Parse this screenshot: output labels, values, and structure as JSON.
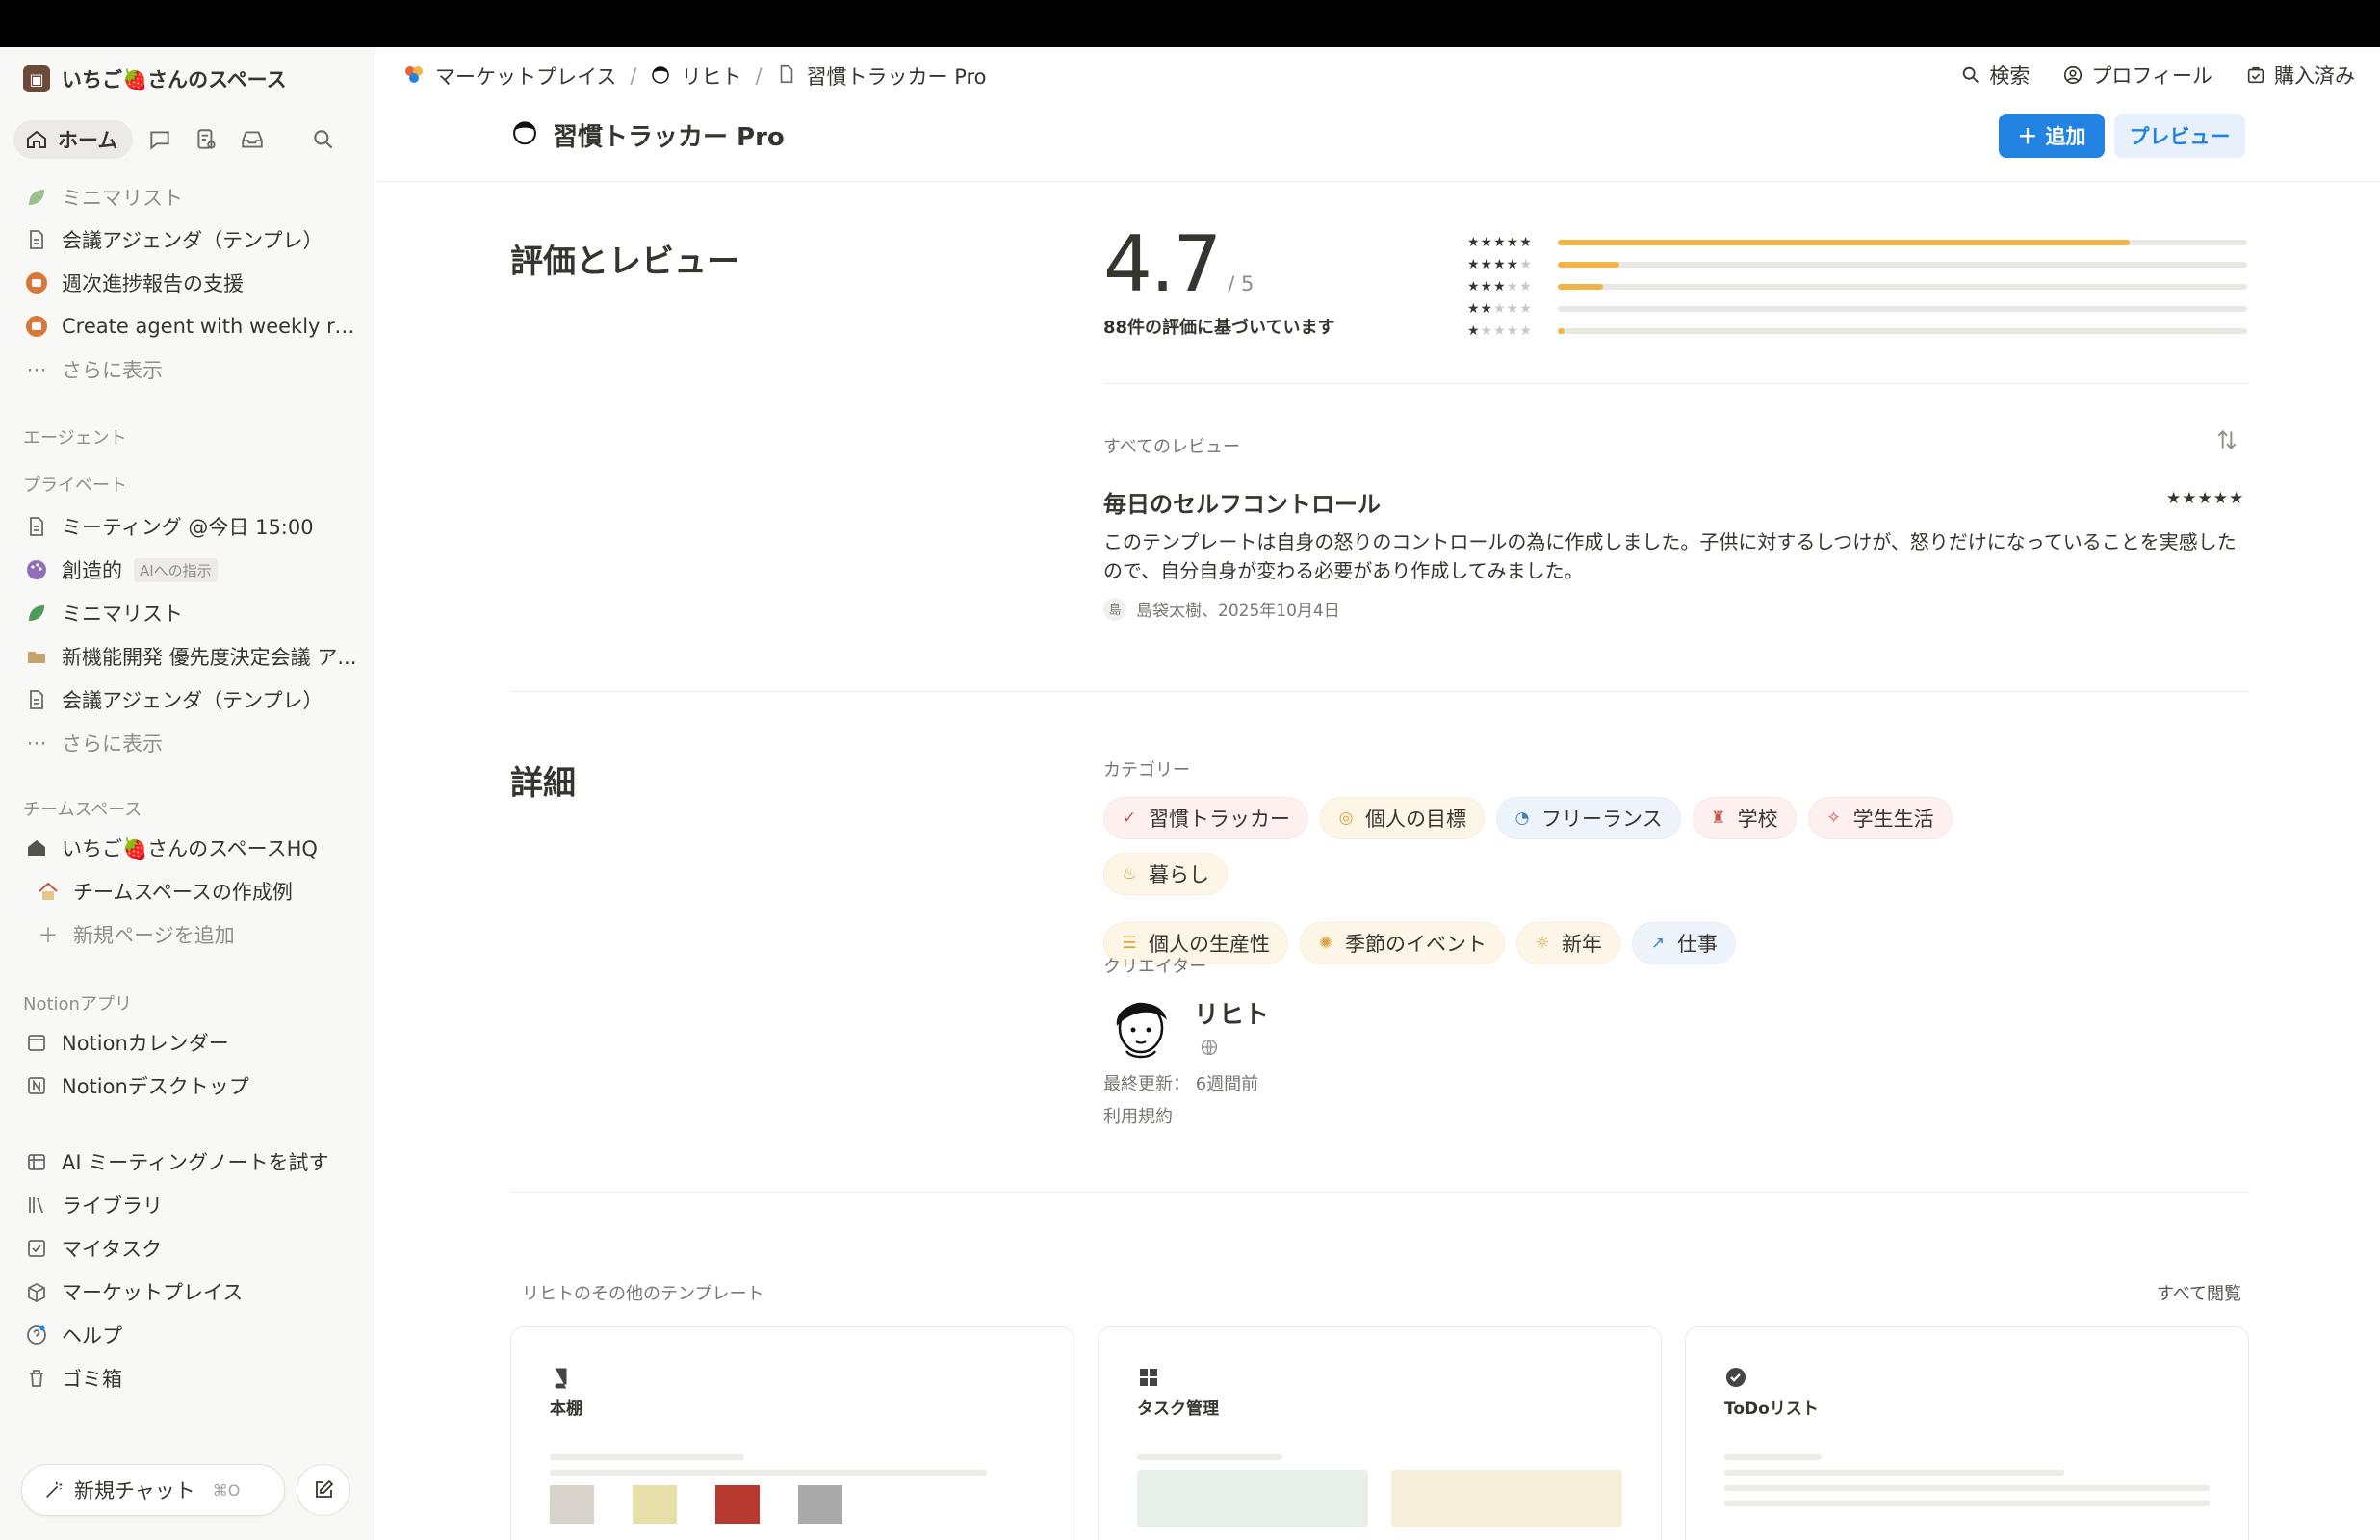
{
  "workspace": {
    "name": "いちご🍓さんのスペース"
  },
  "nav": {
    "home": "ホーム"
  },
  "sidebar": {
    "recent": [
      {
        "label": "ミニマリスト",
        "icon": "leaf-icon"
      },
      {
        "label": "会議アジェンダ（テンプレ）",
        "icon": "page-icon"
      },
      {
        "label": "週次進捗報告の支援",
        "icon": "agent-icon"
      },
      {
        "label": "Create agent with weekly rep...",
        "icon": "agent-icon"
      }
    ],
    "more1": "さらに表示",
    "agents_head": "エージェント",
    "private_head": "プライベート",
    "private": [
      {
        "label": "ミーティング @今日 15:00",
        "icon": "page-icon"
      },
      {
        "label": "創造的",
        "icon": "palette-icon",
        "tag": "AIへの指示"
      },
      {
        "label": "ミニマリスト",
        "icon": "leaf-icon"
      },
      {
        "label": "新機能開発 優先度決定会議 ア...",
        "icon": "folder-icon"
      },
      {
        "label": "会議アジェンダ（テンプレ）",
        "icon": "page-icon"
      }
    ],
    "more2": "さらに表示",
    "team_head": "チームスペース",
    "team": [
      {
        "label": "いちご🍓さんのスペースHQ",
        "icon": "home-icon"
      },
      {
        "label": "チームスペースの作成例",
        "icon": "house-emoji-icon"
      },
      {
        "label": "新規ページを追加",
        "icon": "plus-icon"
      }
    ],
    "apps_head": "Notionアプリ",
    "apps": [
      {
        "label": "Notionカレンダー",
        "icon": "calendar-icon"
      },
      {
        "label": "Notionデスクトップ",
        "icon": "notion-icon"
      }
    ],
    "bottom": [
      {
        "label": "AI ミーティングノートを試す",
        "icon": "calendar-grid-icon"
      },
      {
        "label": "ライブラリ",
        "icon": "library-icon"
      },
      {
        "label": "マイタスク",
        "icon": "checkbox-icon"
      },
      {
        "label": "マーケットプレイス",
        "icon": "marketplace-icon"
      },
      {
        "label": "ヘルプ",
        "icon": "help-icon"
      },
      {
        "label": "ゴミ箱",
        "icon": "trash-icon"
      }
    ],
    "new_chat": "新規チャット",
    "new_chat_kbd": "⌘O"
  },
  "breadcrumb": [
    "マーケットプレイス",
    "リヒト",
    "習慣トラッカー Pro"
  ],
  "header": {
    "search": "検索",
    "profile": "プロフィール",
    "purchased": "購入済み"
  },
  "title": "習慣トラッカー Pro",
  "buttons": {
    "add": "追加",
    "preview": "プレビュー"
  },
  "ratings": {
    "section_title": "評価とレビュー",
    "score": "4.7",
    "out_of": "/ 5",
    "based_on": "88件の評価に基づいています",
    "distribution": [
      {
        "stars": 5,
        "fraction": 0.83
      },
      {
        "stars": 4,
        "fraction": 0.09
      },
      {
        "stars": 3,
        "fraction": 0.065
      },
      {
        "stars": 2,
        "fraction": 0.0
      },
      {
        "stars": 1,
        "fraction": 0.01
      }
    ]
  },
  "reviews": {
    "label": "すべてのレビュー",
    "items": [
      {
        "title": "毎日のセルフコントロール",
        "stars": "★★★★★",
        "body": "このテンプレートは自身の怒りのコントロールの為に作成しました。子供に対するしつけが、怒りだけになっていることを実感したので、自分自身が変わる必要があり作成してみました。",
        "avatar": "島",
        "meta": "島袋太樹、2025年10月4日"
      }
    ]
  },
  "details": {
    "section_title": "詳細",
    "categories_label": "カテゴリー",
    "categories": [
      {
        "label": "習慣トラッカー",
        "glyph": "✓",
        "bg": "#fdf0ee",
        "fg": "#c4554d"
      },
      {
        "label": "個人の目標",
        "glyph": "◎",
        "bg": "#fdf5e6",
        "fg": "#d9a23a"
      },
      {
        "label": "フリーランス",
        "glyph": "◔",
        "bg": "#eef4fb",
        "fg": "#3f7fc7"
      },
      {
        "label": "学校",
        "glyph": "♜",
        "bg": "#fdf0ee",
        "fg": "#c4554d"
      },
      {
        "label": "学生生活",
        "glyph": "✧",
        "bg": "#fdf0ee",
        "fg": "#c4554d"
      },
      {
        "label": "暮らし",
        "glyph": "♨",
        "bg": "#fdf6e6",
        "fg": "#d9a23a"
      },
      {
        "label": "個人の生産性",
        "glyph": "☰",
        "bg": "#fdf6e6",
        "fg": "#d9a23a"
      },
      {
        "label": "季節のイベント",
        "glyph": "✺",
        "bg": "#fdf6e6",
        "fg": "#d9a23a"
      },
      {
        "label": "新年",
        "glyph": "☼",
        "bg": "#fdf6e6",
        "fg": "#d9a23a"
      },
      {
        "label": "仕事",
        "glyph": "↗",
        "bg": "#eef4fb",
        "fg": "#3f7fc7"
      }
    ],
    "creator_label": "クリエイター",
    "creator_name": "リヒト",
    "last_updated": "最終更新： 6週間前",
    "terms": "利用規約"
  },
  "more_templates": {
    "label": "リヒトのその他のテンプレート",
    "view_all": "すべて閲覧",
    "cards": [
      {
        "name": "本棚",
        "icon": "book-icon"
      },
      {
        "name": "タスク管理",
        "icon": "grid-icon"
      },
      {
        "name": "ToDoリスト",
        "icon": "check-circle-icon"
      }
    ]
  },
  "colors": {
    "accent": "#2383e2",
    "star_bar": "#f2b544"
  }
}
